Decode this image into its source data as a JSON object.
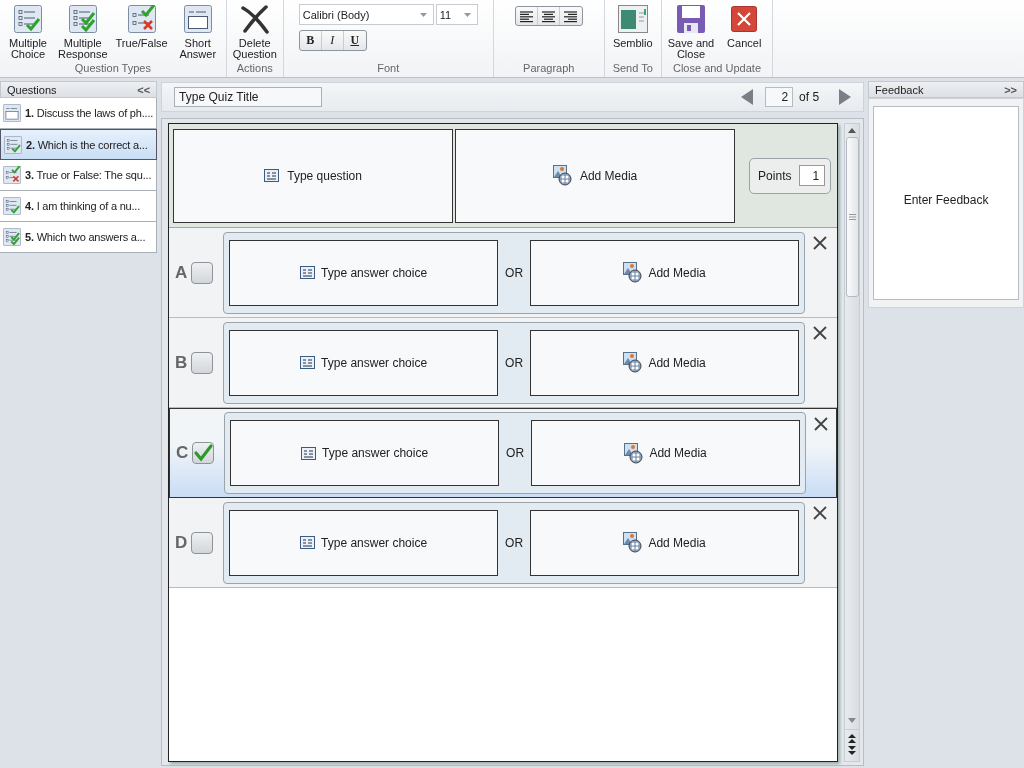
{
  "ribbon": {
    "groups": [
      {
        "kind": "buttons",
        "label": "Question Types",
        "buttons": [
          {
            "kind": "multiple_choice",
            "label": "Multiple\nChoice"
          },
          {
            "kind": "multiple_response",
            "label": "Multiple\nResponse"
          },
          {
            "kind": "true_false",
            "label": "True/False"
          },
          {
            "kind": "short_answer",
            "label": "Short\nAnswer"
          }
        ]
      },
      {
        "kind": "buttons",
        "label": "Actions",
        "buttons": [
          {
            "kind": "delete",
            "label": "Delete\nQuestion"
          }
        ]
      },
      {
        "kind": "font",
        "label": "Font",
        "font": "Calibri (Body)",
        "size": "11",
        "styles": [
          {
            "kind": "bold",
            "text": "B"
          },
          {
            "kind": "italic",
            "text": "I"
          },
          {
            "kind": "underline",
            "text": "U"
          }
        ]
      },
      {
        "kind": "paragraph",
        "label": "Paragraph",
        "alignments": [
          {
            "kind": "left"
          },
          {
            "kind": "center"
          },
          {
            "kind": "right"
          }
        ]
      },
      {
        "kind": "buttons",
        "label": "Send To",
        "buttons": [
          {
            "kind": "send",
            "label": "Semblio"
          }
        ]
      },
      {
        "kind": "buttons",
        "label": "Close and Update",
        "buttons": [
          {
            "kind": "save",
            "label": "Save and\nClose"
          },
          {
            "kind": "cancel",
            "label": "Cancel"
          }
        ]
      }
    ]
  },
  "sidebar": {
    "title": "Questions",
    "collapse": "<<",
    "items": [
      {
        "kind": "short_answer",
        "text": "**1.** Discuss the laws of ph....",
        "selected": false
      },
      {
        "kind": "multiple_choice",
        "text": "**2.** Which is the correct a...",
        "selected": true
      },
      {
        "kind": "true_false",
        "text": "**3.** True or False: The squ...",
        "selected": false
      },
      {
        "kind": "multiple_choice",
        "text": "**4.** I am thinking of a nu...",
        "selected": false
      },
      {
        "kind": "multiple_response",
        "text": "**5.** Which two answers a...",
        "selected": false
      }
    ]
  },
  "quiz": {
    "title_placeholder": "Type Quiz Title",
    "page": "2",
    "page_total": "of 5",
    "question": {
      "placeholder": "Type question",
      "media": "Add Media",
      "points_label": "Points",
      "points": "1"
    },
    "answers": [
      {
        "letter": "A",
        "text": "Type answer choice",
        "or": "OR",
        "media": "Add Media",
        "correct": false,
        "selected": false
      },
      {
        "letter": "B",
        "text": "Type answer choice",
        "or": "OR",
        "media": "Add Media",
        "correct": false,
        "selected": false
      },
      {
        "letter": "C",
        "text": "Type answer choice",
        "or": "OR",
        "media": "Add Media",
        "correct": true,
        "selected": true
      },
      {
        "letter": "D",
        "text": "Type answer choice",
        "or": "OR",
        "media": "Add Media",
        "correct": false,
        "selected": false
      }
    ]
  },
  "feedback": {
    "title": "Feedback",
    "expand": ">>",
    "placeholder": "Enter Feedback"
  }
}
